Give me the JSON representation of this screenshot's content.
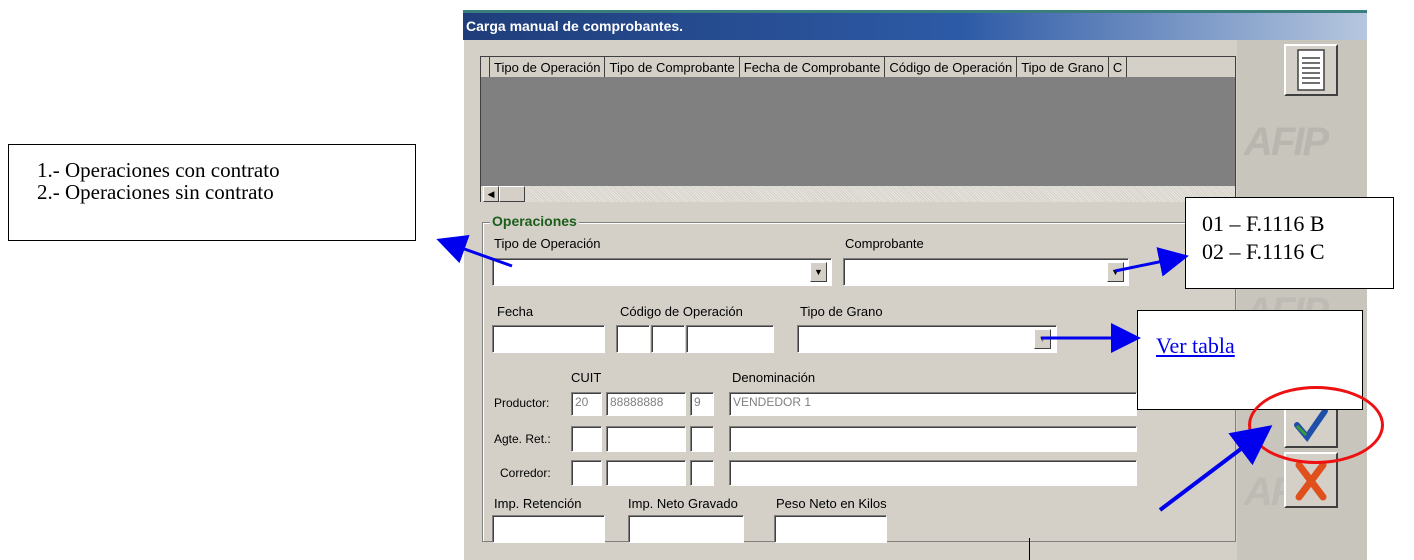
{
  "window": {
    "title": "Carga manual de comprobantes."
  },
  "grid": {
    "columns": [
      "Tipo de Operación",
      "Tipo de Comprobante",
      "Fecha de Comprobante",
      "Código de Operación",
      "Tipo de Grano",
      "C"
    ]
  },
  "operaciones": {
    "group_title": "Operaciones",
    "tipo_operacion_label": "Tipo de Operación",
    "tipo_operacion_value": "",
    "comprobante_label": "Comprobante",
    "comprobante_value": "",
    "fecha_label": "Fecha",
    "codigo_label": "Código de Operación",
    "tipo_grano_label": "Tipo de Grano",
    "tipo_grano_value": "",
    "cuit_header": "CUIT",
    "denominacion_header": "Denominación",
    "productor_label": "Productor:",
    "productor_cuit": [
      "20",
      "88888888",
      "9"
    ],
    "productor_denominacion": "VENDEDOR 1",
    "agte_label": "Agte. Ret.:",
    "corredor_label": "Corredor:",
    "imp_retencion_label": "Imp. Retención",
    "imp_neto_label": "Imp. Neto Gravado",
    "peso_neto_label": "Peso Neto en Kilos"
  },
  "side": {
    "logo_text": "AFIP",
    "list_icon": "list-icon",
    "ok_icon": "checkmark-icon",
    "cancel_icon": "x-icon"
  },
  "annotations": {
    "operaciones_box": [
      "1.- Operaciones con contrato",
      "2.- Operaciones sin contrato"
    ],
    "comprobante_box": [
      "01 – F.1116 B",
      "02 – F.1116 C"
    ],
    "ver_tabla_link": "Ver tabla"
  },
  "colors": {
    "arrow": "#0000ee",
    "highlight": "#ee1111",
    "title_bar": "#1f3d7a",
    "group_title": "#1a5e1a"
  }
}
